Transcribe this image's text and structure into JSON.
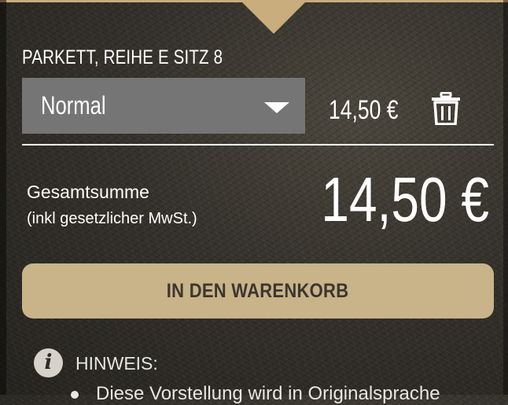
{
  "seat": {
    "title": "PARKETT, REIHE E SITZ 8"
  },
  "ticket": {
    "category": "Normal",
    "price": "14,50 €"
  },
  "total": {
    "label": "Gesamtsumme",
    "sublabel": "(inkl gesetzlicher MwSt.)",
    "amount": "14,50 €"
  },
  "cart": {
    "button_label": "IN DEN WARENKORB"
  },
  "notice": {
    "label": "HINWEIS:",
    "items": [
      "Diese Vorstellung wird in Originalsprache"
    ]
  },
  "icons": {
    "dropdown": "chevron-down-icon",
    "delete": "trash-icon",
    "info": "info-icon"
  },
  "colors": {
    "accent": "#c9ad7c",
    "button": "#c9b388",
    "button_text": "#3b3630",
    "select_bg": "#757575",
    "background": "#2c2a25"
  }
}
